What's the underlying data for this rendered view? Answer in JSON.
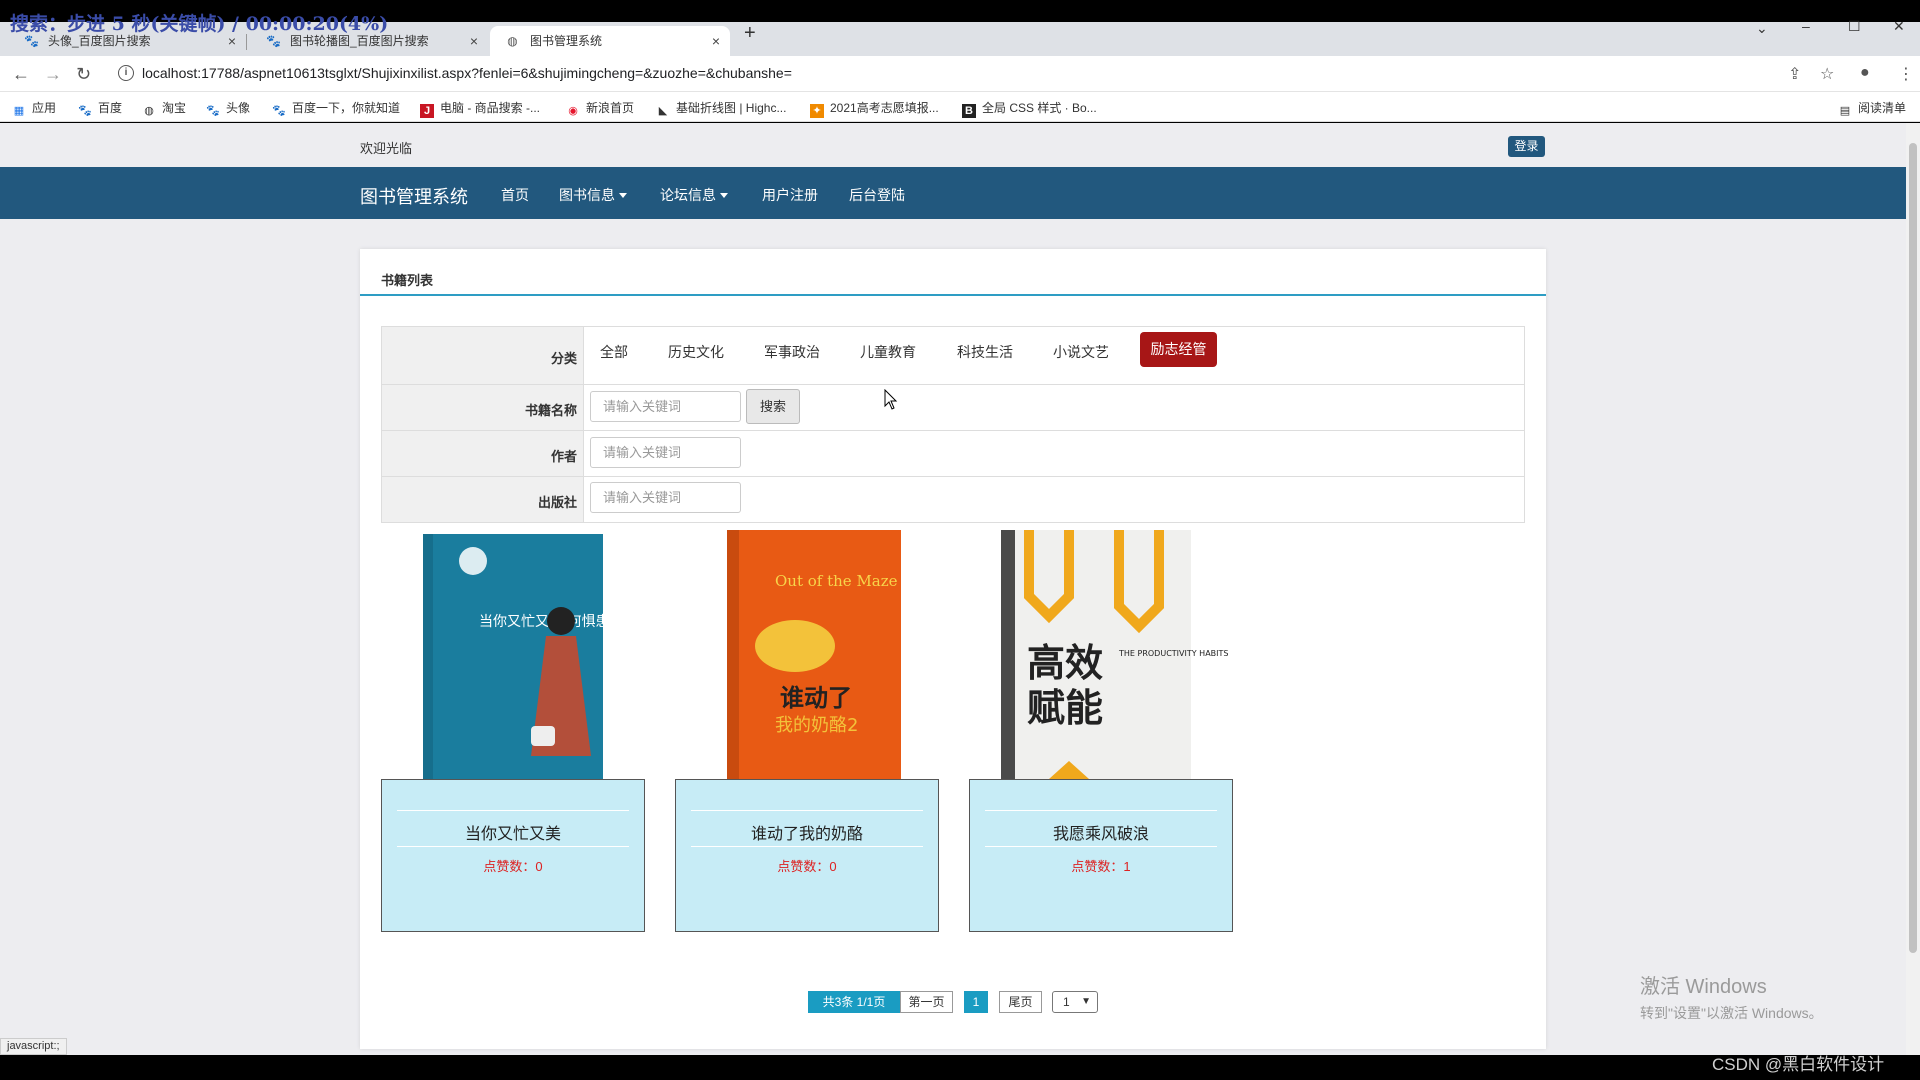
{
  "overlay": {
    "text": "搜索：步进 5 秒(关键帧) / 00:00:20(4%)"
  },
  "browser": {
    "tabs": [
      {
        "title": "头像_百度图片搜索",
        "close": "×"
      },
      {
        "title": "图书轮播图_百度图片搜索",
        "close": "×"
      },
      {
        "title": "图书管理系统",
        "close": "×"
      }
    ],
    "new_tab": "+",
    "url": "localhost:17788/aspnet10613tsglxt/Shujixinxilist.aspx?fenlei=6&shujimingcheng=&zuozhe=&chubanshe=",
    "bookmarks": [
      {
        "label": "应用",
        "icon": "apps-grid-icon"
      },
      {
        "label": "百度",
        "icon": "baidu-paw-icon"
      },
      {
        "label": "淘宝",
        "icon": "globe-icon"
      },
      {
        "label": "头像",
        "icon": "baidu-paw-icon"
      },
      {
        "label": "百度一下，你就知道",
        "icon": "baidu-paw-icon"
      },
      {
        "label": "电脑 - 商品搜索 -...",
        "icon": "jd-icon"
      },
      {
        "label": "新浪首页",
        "icon": "weibo-icon"
      },
      {
        "label": "基础折线图 | Highc...",
        "icon": "highcharts-icon"
      },
      {
        "label": "2021高考志愿填报...",
        "icon": "gaokao-icon"
      },
      {
        "label": "全局 CSS 样式 · Bo...",
        "icon": "bootstrap-icon"
      }
    ],
    "reading_list": "阅读清单"
  },
  "site": {
    "welcome": "欢迎光临",
    "login": "登录",
    "brand": "图书管理系统",
    "nav": [
      "首页",
      "图书信息",
      "论坛信息",
      "用户注册",
      "后台登陆"
    ]
  },
  "panel": {
    "title": "书籍列表",
    "filters": {
      "category_label": "分类",
      "categories": [
        "全部",
        "历史文化",
        "军事政治",
        "儿童教育",
        "科技生活",
        "小说文艺"
      ],
      "active_category": "励志经管",
      "name_label": "书籍名称",
      "author_label": "作者",
      "publisher_label": "出版社",
      "placeholder": "请输入关键词",
      "search_button": "搜索"
    },
    "books": [
      {
        "name": "当你又忙又美",
        "likes": "点赞数：0",
        "cover_title": "当你又忙又美 何惧患得患失"
      },
      {
        "name": "谁动了我的奶酪",
        "likes": "点赞数：0",
        "cover_title": "谁动了",
        "cover_title2": "我的奶酪2",
        "cover_en": "Out of the Maze"
      },
      {
        "name": "我愿乘风破浪",
        "likes": "点赞数：1",
        "cover_title": "高效",
        "cover_title2": "赋能",
        "cover_en": "THE PRODUCTIVITY HABITS"
      }
    ],
    "pager": {
      "info": "共3条  1/1页",
      "first": "第一页",
      "current": "1",
      "last": "尾页",
      "select": "1"
    }
  },
  "status": {
    "link": "javascript:;"
  },
  "watermark": {
    "activate_line1": "激活 Windows",
    "activate_line2": "转到\"设置\"以激活 Windows。",
    "csdn": "CSDN @黑白软件设计"
  }
}
